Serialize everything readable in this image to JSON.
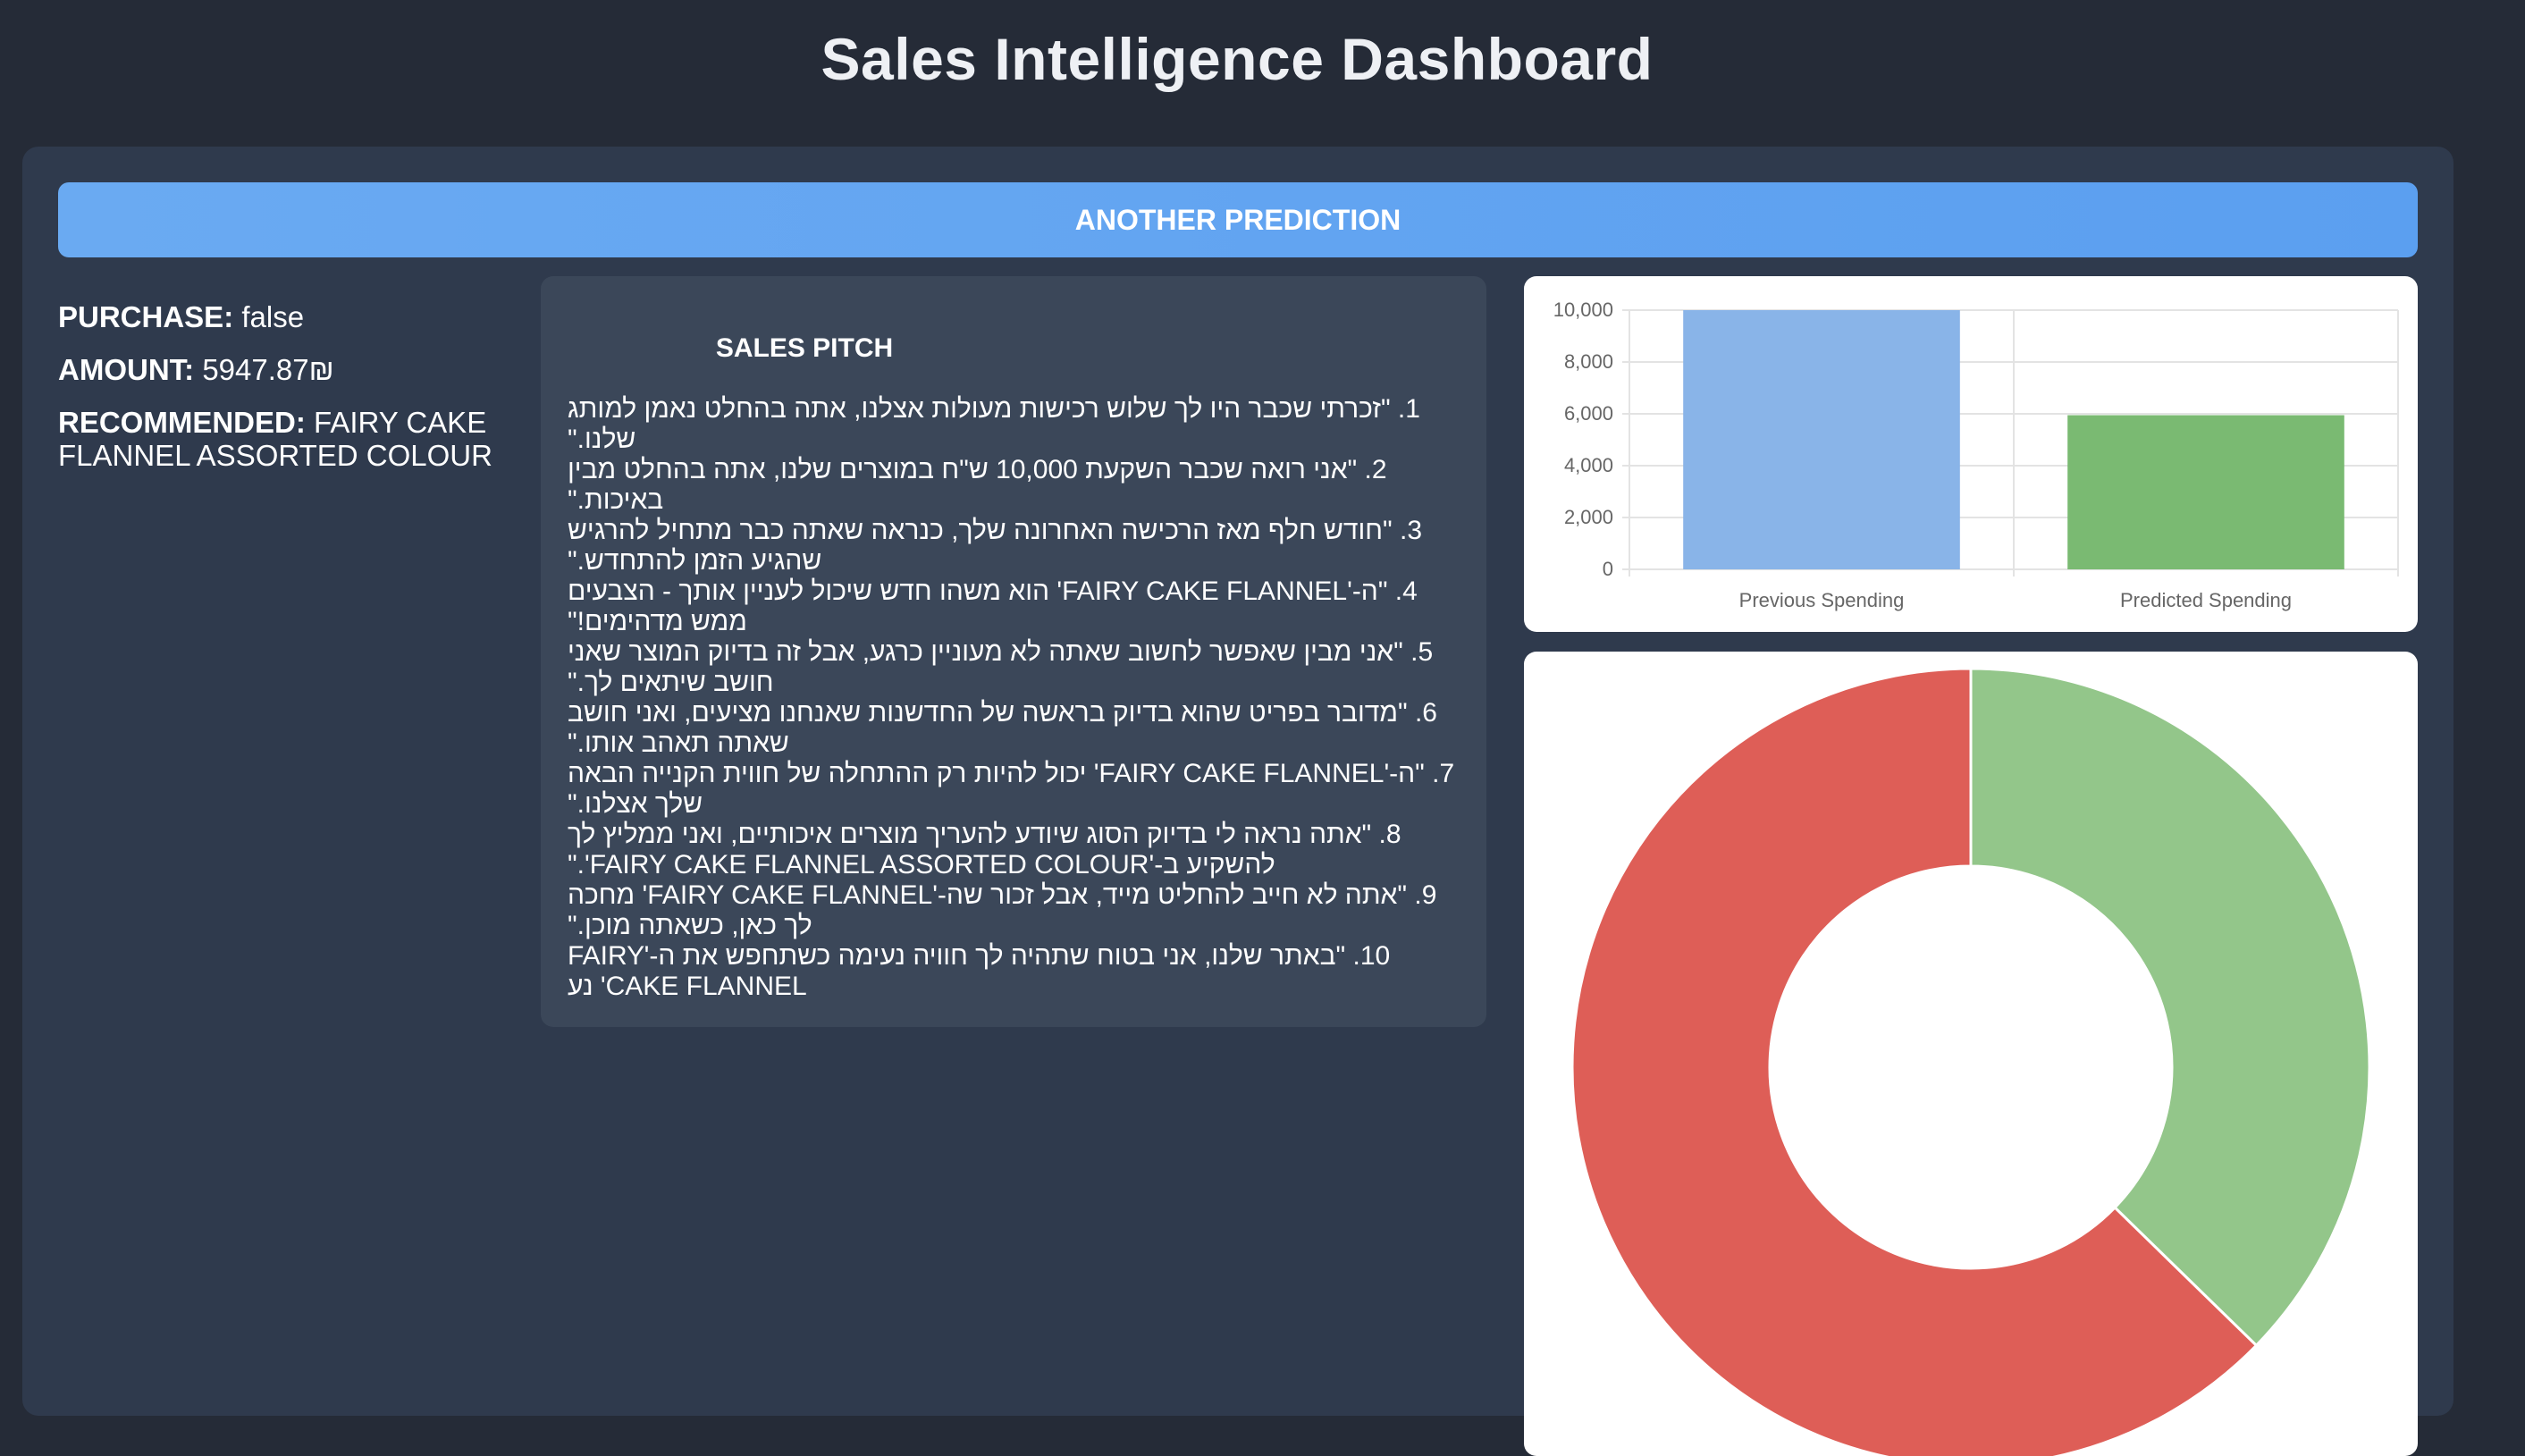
{
  "page": {
    "title": "Sales Intelligence Dashboard"
  },
  "actions": {
    "predict_label": "ANOTHER PREDICTION"
  },
  "summary": {
    "purchase_label": "PURCHASE:",
    "purchase_value": "false",
    "amount_label": "AMOUNT:",
    "amount_value": "5947.87₪",
    "recommended_label": "RECOMMENDED:",
    "recommended_value": "FAIRY CAKE FLANNEL ASSORTED COLOUR"
  },
  "pitch": {
    "title": "SALES PITCH",
    "items": [
      "1. \"זכרתי שכבר היו לך שלוש רכישות מעולות אצלנו, אתה בהחלט נאמן למותג שלנו.\"",
      "2. \"אני רואה שכבר השקעת 10,000 ש\"ח במוצרים שלנו, אתה בהחלט מבין באיכות.\"",
      "3. \"חודש חלף מאז הרכישה האחרונה שלך, כנראה שאתה כבר מתחיל להרגיש שהגיע הזמן להתחדש.\"",
      "4. \"ה-'FAIRY CAKE FLANNEL' הוא משהו חדש שיכול לעניין אותך - הצבעים ממש מדהימים!\"",
      "5. \"אני מבין שאפשר לחשוב שאתה לא מעוניין כרגע, אבל זה בדיוק המוצר שאני חושב שיתאים לך.\"",
      "6. \"מדובר בפריט שהוא בדיוק בראשה של החדשנות שאנחנו מציעים, ואני חושב שאתה תאהב אותו.\"",
      "7. \"ה-'FAIRY CAKE FLANNEL' יכול להיות רק ההתחלה של חווית הקנייה הבאה שלך אצלנו.\"",
      "8. \"אתה נראה לי בדיוק הסוג שיודע להעריך מוצרים איכותיים, ואני ממליץ לך להשקיע ב-'FAIRY CAKE FLANNEL ASSORTED COLOUR'.\"",
      "9. \"אתה לא חייב להחליט מייד, אבל זכור שה-'FAIRY CAKE FLANNEL' מחכה לך כאן, כשאתה מוכן.\"",
      "10. \"באתר שלנו, אני בטוח שתהיה לך חוויה נעימה כשתחפש את ה-'FAIRY CAKE FLANNEL' נע"
    ]
  },
  "chart_data": [
    {
      "type": "bar",
      "categories": [
        "Previous Spending",
        "Predicted Spending"
      ],
      "values": [
        10000,
        5947.87
      ],
      "ylim": [
        0,
        10000
      ],
      "yticks": [
        "0",
        "2,000",
        "4,000",
        "6,000",
        "8,000",
        "10,000"
      ],
      "ytick_values": [
        0,
        2000,
        4000,
        6000,
        8000,
        10000
      ],
      "colors": [
        "#89b4e8",
        "#7aba72"
      ],
      "grid": true
    },
    {
      "type": "pie",
      "donut": true,
      "values": [
        5947.87,
        10000
      ],
      "colors": [
        "#93c68a",
        "#de5e57"
      ]
    }
  ]
}
